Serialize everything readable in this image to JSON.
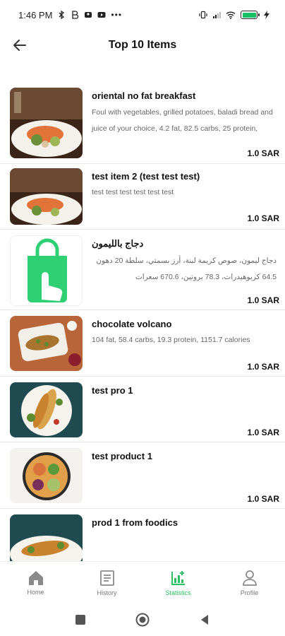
{
  "status": {
    "time": "1:46 PM",
    "icons_left": [
      "bluetooth-icon",
      "b-icon",
      "person-icon",
      "youtube-icon",
      "more-icon"
    ],
    "icons_right": [
      "vibrate-icon",
      "signal-icon",
      "wifi-icon",
      "battery-icon",
      "charging-icon"
    ]
  },
  "header": {
    "title": "Top 10 Items"
  },
  "items": [
    {
      "name": "oriental no fat breakfast",
      "description": "Foul with vegetables, grilled potatoes, baladi bread and juice of your choice, 4.2 fat, 82.5 carbs, 25 protein,",
      "price": "1.0 SAR",
      "image": "salmon-dish"
    },
    {
      "name": "test item 2 (test test test)",
      "description": "test test test test test test",
      "price": "1.0 SAR",
      "image": "salmon-dish"
    },
    {
      "name": "دجاج بالليمون",
      "description": "دجاج ليمون، صوص كريمة لبنة، أرز بسمتي، سلطة 20 دهون 64.5 كربوهيدرات، 78.3 بروتين، 670.6 سعرات",
      "price": "1.0 SAR",
      "image": "shopping-bag-logo"
    },
    {
      "name": "chocolate volcano",
      "description": "104 fat, 58.4 carbs, 19.3 protein, 1151.7 calories",
      "price": "1.0 SAR",
      "image": "kebab-platter"
    },
    {
      "name": "test pro 1",
      "description": "",
      "price": "1.0 SAR",
      "image": "chicken-salad"
    },
    {
      "name": "test product 1",
      "description": "",
      "price": "1.0 SAR",
      "image": "salad-bowl"
    },
    {
      "name": "prod 1 from foodics",
      "description": "",
      "price": "",
      "image": "grilled-plate"
    }
  ],
  "nav": {
    "items": [
      {
        "label": "Home",
        "icon": "home-icon",
        "active": false
      },
      {
        "label": "History",
        "icon": "history-icon",
        "active": false
      },
      {
        "label": "Statistics",
        "icon": "statistics-icon",
        "active": true
      },
      {
        "label": "Profile",
        "icon": "profile-icon",
        "active": false
      }
    ]
  },
  "colors": {
    "accent": "#2dbf63",
    "muted": "#777777"
  }
}
